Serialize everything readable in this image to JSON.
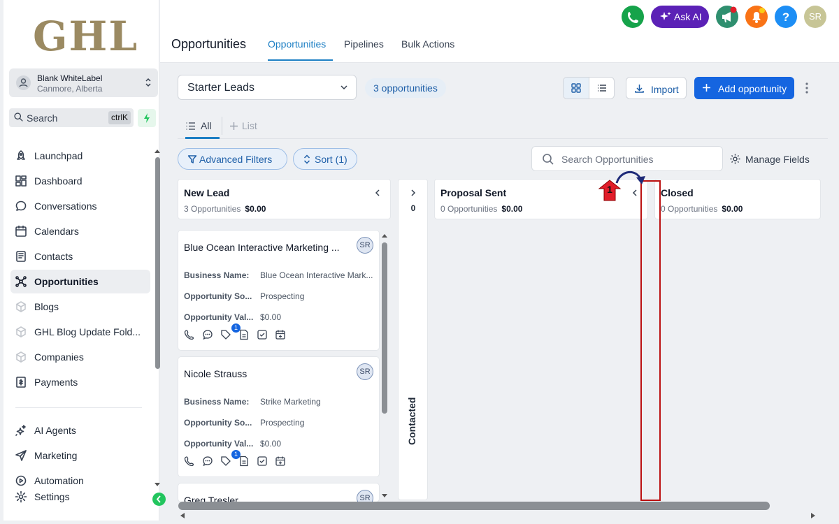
{
  "brand": {
    "logo_text": "GHL"
  },
  "location": {
    "name": "Blank WhiteLabel",
    "sub": "Canmore, Alberta"
  },
  "search": {
    "label": "Search",
    "shortcut": "ctrlK"
  },
  "nav": [
    {
      "label": "Launchpad",
      "icon": "rocket-icon"
    },
    {
      "label": "Dashboard",
      "icon": "dashboard-icon"
    },
    {
      "label": "Conversations",
      "icon": "chat-icon"
    },
    {
      "label": "Calendars",
      "icon": "calendar-icon"
    },
    {
      "label": "Contacts",
      "icon": "contacts-icon"
    },
    {
      "label": "Opportunities",
      "icon": "opportunities-icon",
      "active": true
    },
    {
      "label": "Blogs",
      "icon": "cube-icon"
    },
    {
      "label": "GHL Blog Update Fold...",
      "icon": "cube-icon"
    },
    {
      "label": "Companies",
      "icon": "cube-icon"
    },
    {
      "label": "Payments",
      "icon": "payments-icon"
    },
    {
      "label": "AI Agents",
      "icon": "sparkle-icon"
    },
    {
      "label": "Marketing",
      "icon": "send-icon"
    },
    {
      "label": "Automation",
      "icon": "automation-icon"
    },
    {
      "label": "Settings",
      "icon": "gear-icon"
    }
  ],
  "header": {
    "title": "Opportunities",
    "tabs": [
      "Opportunities",
      "Pipelines",
      "Bulk Actions"
    ],
    "ask_ai": "Ask AI",
    "avatar": "SR"
  },
  "toolbar": {
    "pipeline": "Starter Leads",
    "count": "3 opportunities",
    "import": "Import",
    "add": "Add opportunity"
  },
  "subtabs": {
    "all": "All",
    "list": "List"
  },
  "filters": {
    "advanced": "Advanced Filters",
    "sort": "Sort (1)",
    "search_placeholder": "Search Opportunities",
    "manage": "Manage Fields"
  },
  "stages": [
    {
      "title": "New Lead",
      "count": "3 Opportunities",
      "value": "$0.00"
    },
    {
      "title": "Contacted",
      "count": "0"
    },
    {
      "title": "Proposal Sent",
      "count": "0 Opportunities",
      "value": "$0.00"
    },
    {
      "title": "Closed",
      "count": "0 Opportunities",
      "value": "$0.00"
    }
  ],
  "cards": [
    {
      "title": "Blue Ocean Interactive Marketing ...",
      "avatar": "SR",
      "fields": [
        {
          "label": "Business Name:",
          "value": "Blue Ocean Interactive Mark..."
        },
        {
          "label": "Opportunity So...",
          "value": "Prospecting"
        },
        {
          "label": "Opportunity Val...",
          "value": "$0.00"
        }
      ],
      "badge": "1"
    },
    {
      "title": "Nicole Strauss",
      "avatar": "SR",
      "fields": [
        {
          "label": "Business Name:",
          "value": "Strike Marketing"
        },
        {
          "label": "Opportunity So...",
          "value": "Prospecting"
        },
        {
          "label": "Opportunity Val...",
          "value": "$0.00"
        }
      ],
      "badge": "1"
    },
    {
      "title": "Greg Tresler",
      "avatar": "SR"
    }
  ],
  "annotation": {
    "step": "1"
  },
  "colors": {
    "primary": "#1565e0",
    "accent": "#1d7fc4",
    "ask_ai": "#5b21b6",
    "annotation": "#bb1111"
  }
}
